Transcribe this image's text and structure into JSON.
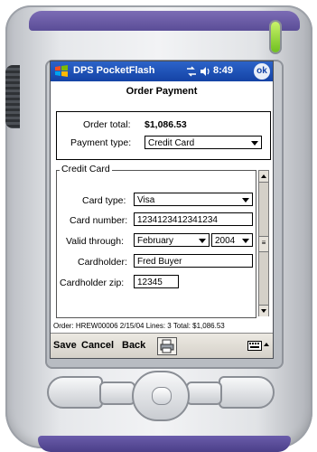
{
  "titlebar": {
    "app_name": "DPS PocketFlash",
    "time": "8:49",
    "ok_label": "ok"
  },
  "page": {
    "title": "Order Payment"
  },
  "summary": {
    "order_total_label": "Order total:",
    "order_total_value": "$1,086.53",
    "payment_type_label": "Payment type:",
    "payment_type_value": "Credit Card"
  },
  "credit_card": {
    "group_label": "Credit Card",
    "card_type_label": "Card type:",
    "card_type_value": "Visa",
    "card_number_label": "Card number:",
    "card_number_value": "1234123412341234",
    "valid_through_label": "Valid through:",
    "valid_month_value": "February",
    "valid_year_value": "2004",
    "cardholder_label": "Cardholder:",
    "cardholder_value": "Fred Buyer",
    "cardholder_zip_label": "Cardholder zip:",
    "cardholder_zip_value": "12345"
  },
  "status": {
    "order_line": "Order: HREW00006 2/15/04 Lines: 3 Total: $1,086.53"
  },
  "command_bar": {
    "save_label": "Save",
    "cancel_label": "Cancel",
    "back_label": "Back",
    "print_icon": "printer-icon",
    "keyboard_icon": "keyboard-icon"
  },
  "colors": {
    "titlebar_blue": "#1443a5",
    "device_accent_purple": "#5a4d97",
    "led_green": "#6fbf1f"
  }
}
